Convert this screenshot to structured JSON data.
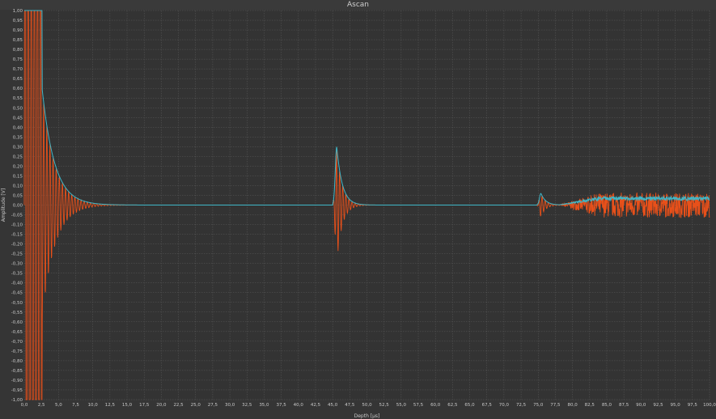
{
  "window": {
    "title": "Ascan"
  },
  "colors": {
    "background": "#353535",
    "plot_bg": "#333333",
    "grid": "#5a5a5a",
    "rf_signal": "#e8501a",
    "envelope": "#3fb7c8"
  },
  "chart_data": {
    "type": "line",
    "title": "Ascan",
    "xlabel": "Depth [µs]",
    "ylabel": "Amplitude [V]",
    "xlim": [
      0,
      100
    ],
    "ylim": [
      -1,
      1
    ],
    "x_ticks": [
      "0,0",
      "2,5",
      "5,0",
      "7,5",
      "10,0",
      "12,5",
      "15,0",
      "17,5",
      "20,0",
      "22,5",
      "25,0",
      "27,5",
      "30,0",
      "32,5",
      "35,0",
      "37,5",
      "40,0",
      "42,5",
      "45,0",
      "47,5",
      "50,0",
      "52,5",
      "55,0",
      "57,5",
      "60,0",
      "62,5",
      "65,0",
      "67,5",
      "70,0",
      "72,5",
      "75,0",
      "77,5",
      "80,0",
      "82,5",
      "85,0",
      "87,5",
      "90,0",
      "92,5",
      "95,0",
      "97,5",
      "100,0"
    ],
    "y_ticks": [
      "1,00",
      "0,95",
      "0,90",
      "0,85",
      "0,80",
      "0,75",
      "0,70",
      "0,65",
      "0,60",
      "0,55",
      "0,50",
      "0,45",
      "0,40",
      "0,35",
      "0,30",
      "0,25",
      "0,20",
      "0,15",
      "0,10",
      "0,05",
      "0,00",
      "-0,05",
      "-0,10",
      "-0,15",
      "-0,20",
      "-0,25",
      "-0,30",
      "-0,35",
      "-0,40",
      "-0,45",
      "-0,50",
      "-0,55",
      "-0,60",
      "-0,65",
      "-0,70",
      "-0,75",
      "-0,80",
      "-0,85",
      "-0,90",
      "-0,95",
      "-1,00"
    ],
    "grid": true,
    "echoes": [
      {
        "center": 0.3,
        "amplitude": 1.0,
        "decay": 1.8
      },
      {
        "center": 45.6,
        "amplitude": 0.3,
        "decay": 0.8
      },
      {
        "center": 75.4,
        "amplitude": 0.06,
        "decay": 0.7
      }
    ],
    "series": [
      {
        "role": "rf",
        "description": "RF A-scan signal"
      },
      {
        "role": "envelope",
        "description": "Envelope of RF signal"
      }
    ],
    "noise_region": {
      "start": 82,
      "end": 100,
      "amplitude": 0.04
    }
  }
}
